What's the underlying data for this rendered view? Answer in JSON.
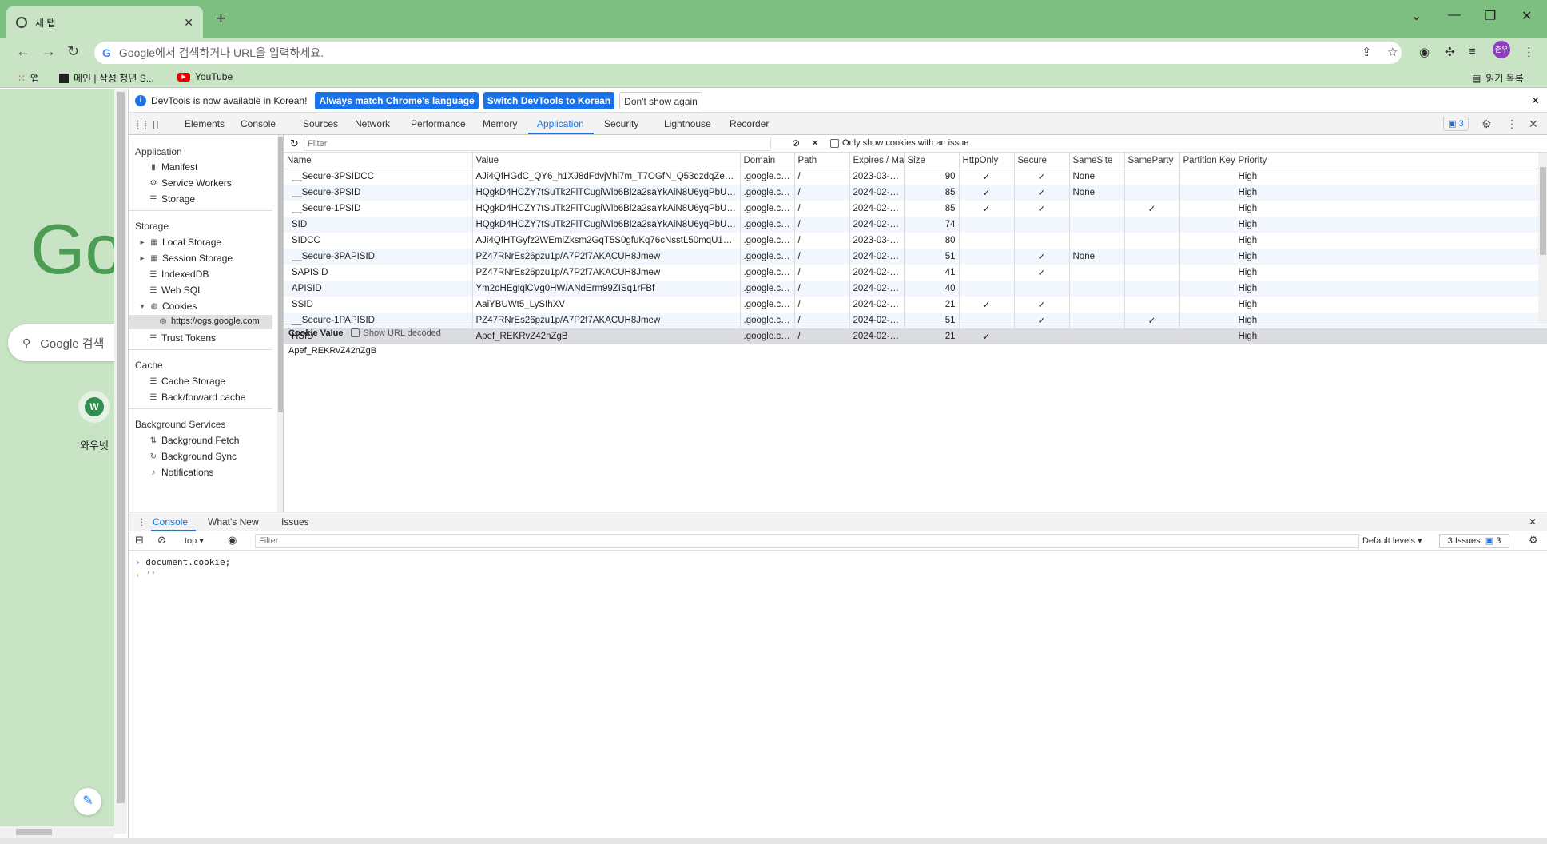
{
  "browser": {
    "tab_title": "새 탭",
    "new_tab_label": "+",
    "omnibox_text": "Google에서 검색하거나 URL을 입력하세요.",
    "profile_initials": "준우",
    "bookmarks": [
      "앱",
      "메인 | 삼성 청년 S...",
      "YouTube"
    ],
    "reading_list": "읽기 목록"
  },
  "page": {
    "logo_text": "Go",
    "search_placeholder": "Google 검색",
    "shortcut_initial": "W",
    "shortcut_label": "와우넷"
  },
  "devtools": {
    "infobar": {
      "message": "DevTools is now available in Korean!",
      "btn_match": "Always match Chrome's language",
      "btn_switch": "Switch DevTools to Korean",
      "btn_dismiss": "Don't show again"
    },
    "tabs": [
      "Elements",
      "Console",
      "Sources",
      "Network",
      "Performance",
      "Memory",
      "Application",
      "Security",
      "Lighthouse",
      "Recorder"
    ],
    "issues_count": "3",
    "sidebar": {
      "application_header": "Application",
      "application_items": [
        "Manifest",
        "Service Workers",
        "Storage"
      ],
      "storage_header": "Storage",
      "storage_items": [
        "Local Storage",
        "Session Storage",
        "IndexedDB",
        "Web SQL",
        "Cookies"
      ],
      "cookie_origin": "https://ogs.google.com",
      "trust_tokens": "Trust Tokens",
      "cache_header": "Cache",
      "cache_items": [
        "Cache Storage",
        "Back/forward cache"
      ],
      "bg_header": "Background Services",
      "bg_items": [
        "Background Fetch",
        "Background Sync",
        "Notifications"
      ]
    },
    "cookies": {
      "filter_placeholder": "Filter",
      "only_issue_label": "Only show cookies with an issue",
      "columns": [
        "Name",
        "Value",
        "Domain",
        "Path",
        "Expires / Ma...",
        "Size",
        "HttpOnly",
        "Secure",
        "SameSite",
        "SameParty",
        "Partition Key",
        "Priority"
      ],
      "rows": [
        [
          "__Secure-3PSIDCC",
          "AJi4QfHGdC_QY6_h1XJ8dFdvjVhl7m_T7OGfN_Q53dzdqZexuiBLUbtzlURLA...",
          ".google.com",
          "/",
          "2023-03-17...",
          "90",
          "✓",
          "✓",
          "None",
          "",
          "",
          "High"
        ],
        [
          "__Secure-3PSID",
          "HQgkD4HCZY7tSuTk2FlTCugiWlb6Bl2a2saYkAiN8U6yqPbUYiiFZnpiaJNLjIK...",
          ".google.com",
          "/",
          "2024-02-23...",
          "85",
          "✓",
          "✓",
          "None",
          "",
          "",
          "High"
        ],
        [
          "__Secure-1PSID",
          "HQgkD4HCZY7tSuTk2FlTCugiWlb6Bl2a2saYkAiN8U6yqPbUH5le_u1b0WXA...",
          ".google.com",
          "/",
          "2024-02-23...",
          "85",
          "✓",
          "✓",
          "",
          "✓",
          "",
          "High"
        ],
        [
          "SID",
          "HQgkD4HCZY7tSuTk2FlTCugiWlb6Bl2a2saYkAiN8U6yqPbUEfJxFMdFwc0w...",
          ".google.com",
          "/",
          "2024-02-23...",
          "74",
          "",
          "",
          "",
          "",
          "",
          "High"
        ],
        [
          "SIDCC",
          "AJi4QfHTGyfz2WEmlZksm2GqT5S0gfuKq76cNsstL50mqU16DANKG6AF2z6...",
          ".google.com",
          "/",
          "2023-03-17...",
          "80",
          "",
          "",
          "",
          "",
          "",
          "High"
        ],
        [
          "__Secure-3PAPISID",
          "PZ47RNrEs26pzu1p/A7P2f7AKACUH8Jmew",
          ".google.com",
          "/",
          "2024-02-23...",
          "51",
          "",
          "✓",
          "None",
          "",
          "",
          "High"
        ],
        [
          "SAPISID",
          "PZ47RNrEs26pzu1p/A7P2f7AKACUH8Jmew",
          ".google.com",
          "/",
          "2024-02-23...",
          "41",
          "",
          "✓",
          "",
          "",
          "",
          "High"
        ],
        [
          "APISID",
          "Ym2oHEglqlCVg0HW/ANdErm99ZISq1rFBf",
          ".google.com",
          "/",
          "2024-02-23...",
          "40",
          "",
          "",
          "",
          "",
          "",
          "High"
        ],
        [
          "SSID",
          "AaiYBUWt5_LySIhXV",
          ".google.com",
          "/",
          "2024-02-23...",
          "21",
          "✓",
          "✓",
          "",
          "",
          "",
          "High"
        ],
        [
          "__Secure-1PAPISID",
          "PZ47RNrEs26pzu1p/A7P2f7AKACUH8Jmew",
          ".google.com",
          "/",
          "2024-02-23...",
          "51",
          "",
          "✓",
          "",
          "✓",
          "",
          "High"
        ],
        [
          "HSID",
          "Apef_REKRvZ42nZgB",
          ".google.com",
          "/",
          "2024-02-23...",
          "21",
          "✓",
          "",
          "",
          "",
          "",
          "High"
        ]
      ],
      "selected_row": 10,
      "value_label": "Cookie Value",
      "url_decoded_label": "Show URL decoded",
      "selected_value": "Apef_REKRvZ42nZgB"
    },
    "drawer": {
      "tabs": [
        "Console",
        "What's New",
        "Issues"
      ],
      "context": "top",
      "filter_placeholder": "Filter",
      "levels": "Default levels",
      "issues_label": "3 Issues:",
      "issues_count": "3",
      "input_line": "document.cookie;",
      "output_line": "''"
    }
  }
}
